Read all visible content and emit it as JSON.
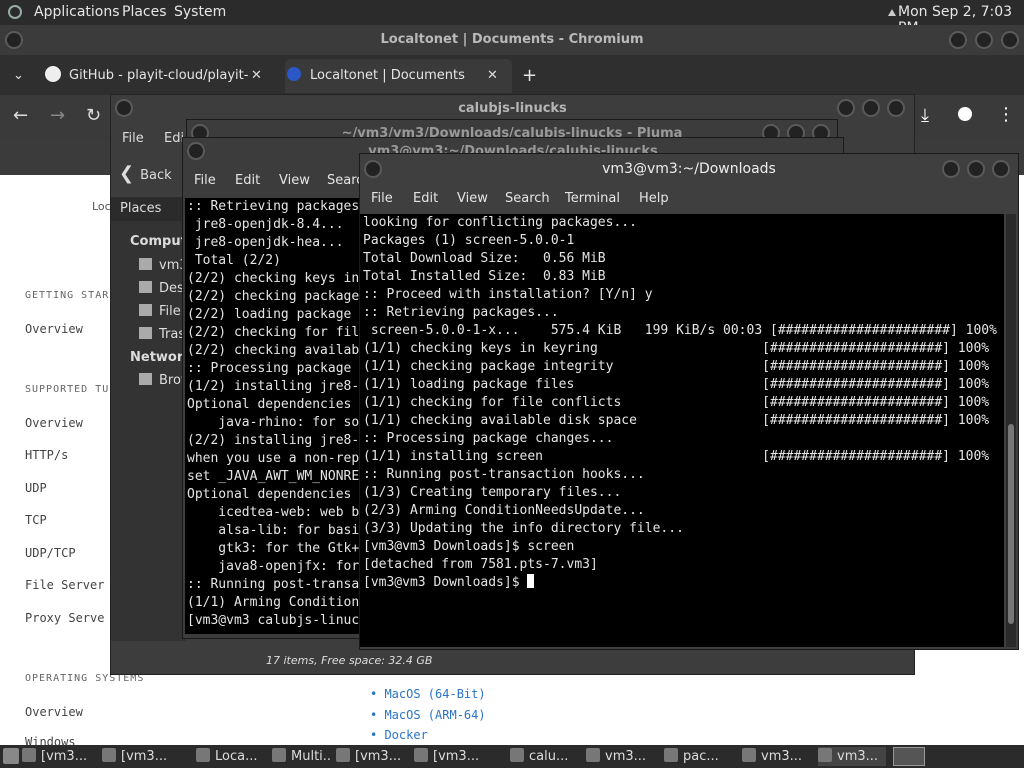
{
  "panel": {
    "apps": "Applications",
    "places": "Places",
    "system": "System",
    "clock": "Mon Sep  2,  7:03 PM"
  },
  "chromium": {
    "title": "Localtonet | Documents - Chromium",
    "tabs": [
      {
        "label": "GitHub - playit-cloud/playit-"
      },
      {
        "label": "Localtonet | Documents"
      }
    ],
    "nav": {
      "getting_started": "GETTING STAR",
      "overview1": "Overview",
      "supported": "SUPPORTED TU",
      "overview2": "Overview",
      "http": "HTTP/s",
      "udp": "UDP",
      "tcp": "TCP",
      "udptcp": "UDP/TCP",
      "file_server": "File Server",
      "proxy_server": "Proxy Serve",
      "os": "OPERATING SYSTEMS",
      "overview3": "Overview",
      "windows": "Windows"
    },
    "logo_text": "Loc",
    "os_links": [
      "MacOS (64-Bit)",
      "MacOS (ARM-64)",
      "Docker"
    ]
  },
  "caja": {
    "title": "calubjs-linucks",
    "menu": {
      "file": "File",
      "edit": "Edi"
    },
    "back": "Back",
    "places_select": "Places",
    "sidebar": {
      "computer": "Computer",
      "items": [
        "vm3",
        "Desktop",
        "File System",
        "Trash"
      ],
      "network": "Network",
      "browse": "Browse Network"
    },
    "status": "17 items, Free space: 32.4 GB"
  },
  "pluma": {
    "title": "~/vm3/vm3/Downloads/calubjs-linucks - Pluma"
  },
  "term1": {
    "title": "vm3@vm3:~/Downloads/calubjs-linucks",
    "menu": [
      "File",
      "Edit",
      "View",
      "Search"
    ],
    "lines": [
      ":: Retrieving packages...",
      " jre8-openjdk-8.4...",
      " jre8-openjdk-hea...",
      " Total (2/2)",
      "(2/2) checking keys in keyring",
      "(2/2) checking package integrity",
      "(2/2) loading package files",
      "(2/2) checking for file conflicts",
      "(2/2) checking available disk space",
      ":: Processing package changes...",
      "(1/2) installing jre8-openjdk-headless",
      "Optional dependencies for jre8-openjdk-headless",
      "    java-rhino: for some JavaScript support",
      "(2/2) installing jre8-openjdk",
      "when you use a non-reparenting window manager,",
      "set _JAVA_AWT_WM_NONREPARENTING=1",
      "Optional dependencies for jre8-openjdk",
      "    icedtea-web: web browser plugin",
      "    alsa-lib: for basic sound support",
      "    gtk3: for the Gtk+ 3 look and feel",
      "    java8-openjfx: for JavaFX support",
      ":: Running post-transaction hooks...",
      "(1/1) Arming ConditionNeedsUpdate...",
      "[vm3@vm3 calubjs-linucks]$ "
    ]
  },
  "term2": {
    "title": "vm3@vm3:~/Downloads",
    "menu": [
      "File",
      "Edit",
      "View",
      "Search",
      "Terminal",
      "Help"
    ],
    "lines": [
      "looking for conflicting packages...",
      "",
      "Packages (1) screen-5.0.0-1",
      "",
      "Total Download Size:   0.56 MiB",
      "Total Installed Size:  0.83 MiB",
      "",
      ":: Proceed with installation? [Y/n] y",
      ":: Retrieving packages...",
      " screen-5.0.0-1-x...    575.4 KiB   199 KiB/s 00:03 [######################] 100%",
      "(1/1) checking keys in keyring                     [######################] 100%",
      "(1/1) checking package integrity                   [######################] 100%",
      "(1/1) loading package files                        [######################] 100%",
      "(1/1) checking for file conflicts                  [######################] 100%",
      "(1/1) checking available disk space                [######################] 100%",
      ":: Processing package changes...",
      "(1/1) installing screen                            [######################] 100%",
      ":: Running post-transaction hooks...",
      "(1/3) Creating temporary files...",
      "(2/3) Arming ConditionNeedsUpdate...",
      "(3/3) Updating the info directory file...",
      "[vm3@vm3 Downloads]$ screen",
      "[detached from 7581.pts-7.vm3]",
      "[vm3@vm3 Downloads]$ "
    ]
  },
  "taskbar": [
    {
      "label": "[vm3..."
    },
    {
      "label": "[vm3..."
    },
    {
      "label": "Loca..."
    },
    {
      "label": "Multi..."
    },
    {
      "label": "[vm3..."
    },
    {
      "label": "[vm3..."
    },
    {
      "label": "calu..."
    },
    {
      "label": "vm3..."
    },
    {
      "label": "pac..."
    },
    {
      "label": "vm3..."
    },
    {
      "label": "vm3..."
    }
  ]
}
